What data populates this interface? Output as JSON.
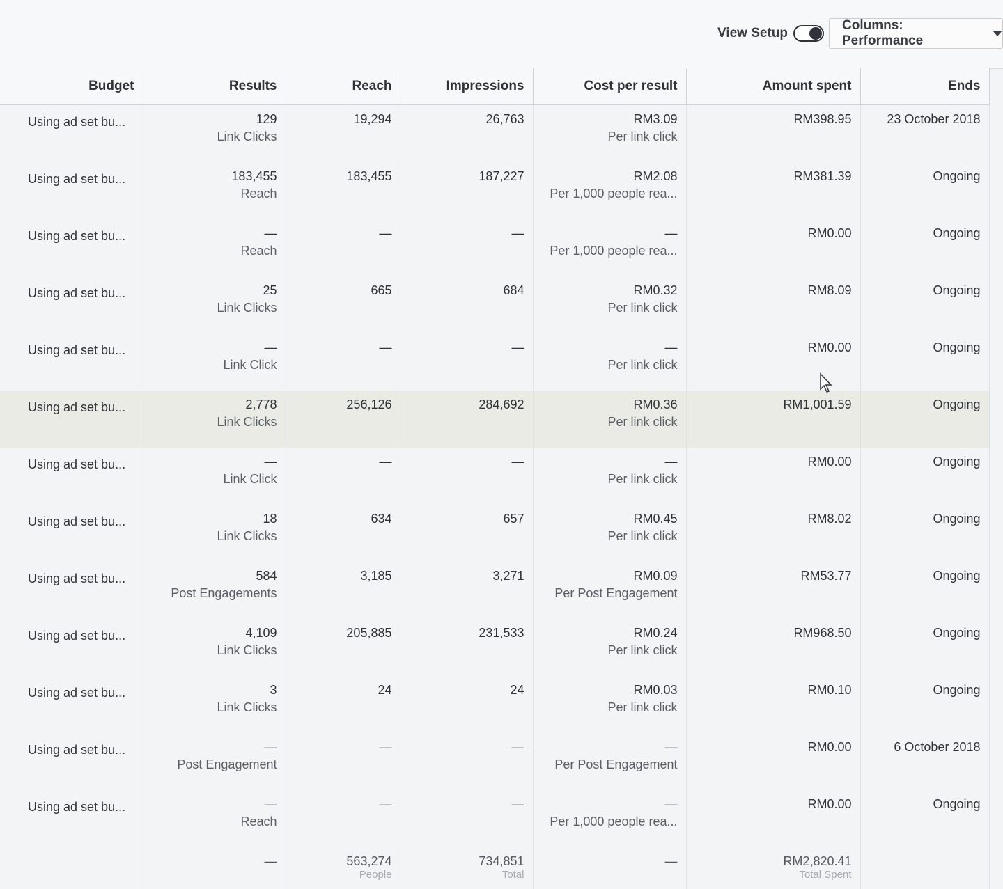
{
  "toolbar": {
    "view_setup_label": "View Setup",
    "columns_label": "Columns: Performance"
  },
  "table": {
    "headers": {
      "budget": "Budget",
      "results": "Results",
      "reach": "Reach",
      "impressions": "Impressions",
      "cost_per_result": "Cost per result",
      "amount_spent": "Amount spent",
      "ends": "Ends"
    },
    "rows": [
      {
        "budget": "Using ad set bu...",
        "results": "129",
        "results_type": "Link Clicks",
        "reach": "19,294",
        "impressions": "26,763",
        "cost": "RM3.09",
        "cost_type": "Per link click",
        "amount": "RM398.95",
        "ends": "23 October 2018"
      },
      {
        "budget": "Using ad set bu...",
        "results": "183,455",
        "results_type": "Reach",
        "reach": "183,455",
        "impressions": "187,227",
        "cost": "RM2.08",
        "cost_type": "Per 1,000 people rea...",
        "amount": "RM381.39",
        "ends": "Ongoing"
      },
      {
        "budget": "Using ad set bu...",
        "results": "—",
        "results_type": "Reach",
        "reach": "—",
        "impressions": "—",
        "cost": "—",
        "cost_type": "Per 1,000 people rea...",
        "amount": "RM0.00",
        "ends": "Ongoing"
      },
      {
        "budget": "Using ad set bu...",
        "results": "25",
        "results_type": "Link Clicks",
        "reach": "665",
        "impressions": "684",
        "cost": "RM0.32",
        "cost_type": "Per link click",
        "amount": "RM8.09",
        "ends": "Ongoing"
      },
      {
        "budget": "Using ad set bu...",
        "results": "—",
        "results_type": "Link Click",
        "reach": "—",
        "impressions": "—",
        "cost": "—",
        "cost_type": "Per link click",
        "amount": "RM0.00",
        "ends": "Ongoing"
      },
      {
        "budget": "Using ad set bu...",
        "results": "2,778",
        "results_type": "Link Clicks",
        "reach": "256,126",
        "impressions": "284,692",
        "cost": "RM0.36",
        "cost_type": "Per link click",
        "amount": "RM1,001.59",
        "ends": "Ongoing"
      },
      {
        "budget": "Using ad set bu...",
        "results": "—",
        "results_type": "Link Click",
        "reach": "—",
        "impressions": "—",
        "cost": "—",
        "cost_type": "Per link click",
        "amount": "RM0.00",
        "ends": "Ongoing"
      },
      {
        "budget": "Using ad set bu...",
        "results": "18",
        "results_type": "Link Clicks",
        "reach": "634",
        "impressions": "657",
        "cost": "RM0.45",
        "cost_type": "Per link click",
        "amount": "RM8.02",
        "ends": "Ongoing"
      },
      {
        "budget": "Using ad set bu...",
        "results": "584",
        "results_type": "Post Engagements",
        "reach": "3,185",
        "impressions": "3,271",
        "cost": "RM0.09",
        "cost_type": "Per Post Engagement",
        "amount": "RM53.77",
        "ends": "Ongoing"
      },
      {
        "budget": "Using ad set bu...",
        "results": "4,109",
        "results_type": "Link Clicks",
        "reach": "205,885",
        "impressions": "231,533",
        "cost": "RM0.24",
        "cost_type": "Per link click",
        "amount": "RM968.50",
        "ends": "Ongoing"
      },
      {
        "budget": "Using ad set bu...",
        "results": "3",
        "results_type": "Link Clicks",
        "reach": "24",
        "impressions": "24",
        "cost": "RM0.03",
        "cost_type": "Per link click",
        "amount": "RM0.10",
        "ends": "Ongoing"
      },
      {
        "budget": "Using ad set bu...",
        "results": "—",
        "results_type": "Post Engagement",
        "reach": "—",
        "impressions": "—",
        "cost": "—",
        "cost_type": "Per Post Engagement",
        "amount": "RM0.00",
        "ends": "6 October 2018"
      },
      {
        "budget": "Using ad set bu...",
        "results": "—",
        "results_type": "Reach",
        "reach": "—",
        "impressions": "—",
        "cost": "—",
        "cost_type": "Per 1,000 people rea...",
        "amount": "RM0.00",
        "ends": "Ongoing"
      }
    ],
    "totals": {
      "results": "—",
      "reach": "563,274",
      "reach_label": "People",
      "impressions": "734,851",
      "impressions_label": "Total",
      "cost": "—",
      "amount": "RM2,820.41",
      "amount_label": "Total Spent"
    }
  }
}
